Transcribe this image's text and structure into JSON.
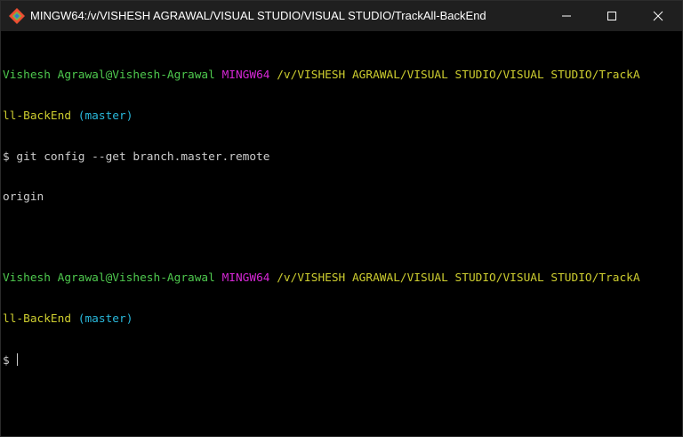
{
  "window": {
    "title": "MINGW64:/v/VISHESH AGRAWAL/VISUAL STUDIO/VISUAL STUDIO/TrackAll-BackEnd"
  },
  "titlebar_buttons": {
    "minimize_icon": "minimize-icon",
    "maximize_icon": "maximize-icon",
    "close_icon": "close-icon"
  },
  "terminal": {
    "prompt1": {
      "user_host": "Vishesh Agrawal@Vishesh-Agrawal",
      "env": "MINGW64",
      "path_part1": "/v/VISHESH AGRAWAL/VISUAL STUDIO/VISUAL STUDIO/TrackA",
      "path_part2": "ll-BackEnd",
      "branch": "(master)"
    },
    "command1": "$ git config --get branch.master.remote",
    "output1": "origin",
    "prompt2": {
      "user_host": "Vishesh Agrawal@Vishesh-Agrawal",
      "env": "MINGW64",
      "path_part1": "/v/VISHESH AGRAWAL/VISUAL STUDIO/VISUAL STUDIO/TrackA",
      "path_part2": "ll-BackEnd",
      "branch": "(master)"
    },
    "prompt_symbol": "$"
  },
  "colors": {
    "user_host": "#23d18b",
    "env": "#d627d6",
    "path": "#cdcd2f",
    "branch": "#29b8db",
    "text": "#cccccc",
    "background": "#000000",
    "titlebar": "#1f1f1f"
  }
}
